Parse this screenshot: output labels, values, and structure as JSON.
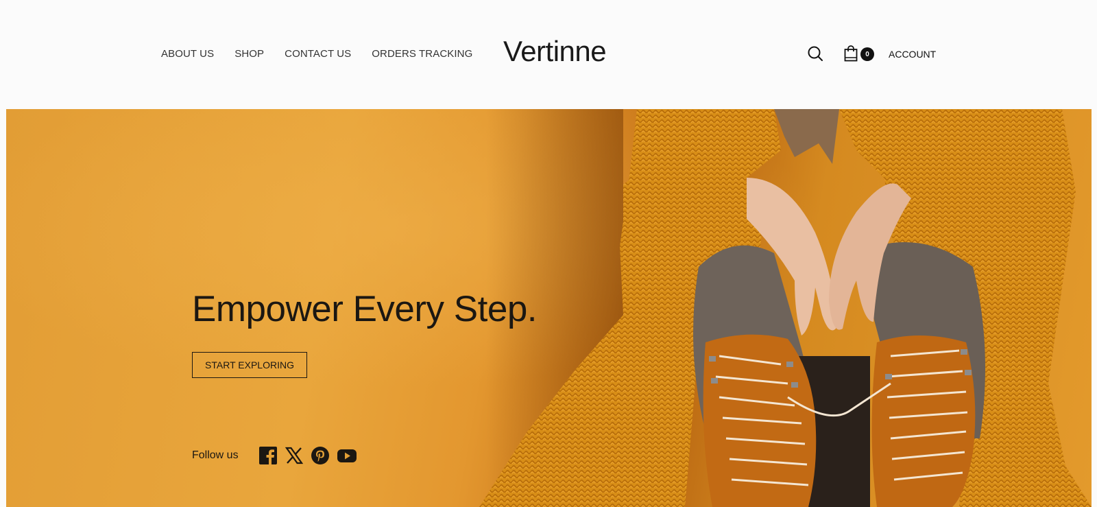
{
  "header": {
    "nav": [
      {
        "label": "ABOUT US"
      },
      {
        "label": "SHOP"
      },
      {
        "label": "CONTACT US"
      },
      {
        "label": "ORDERS TRACKING"
      }
    ],
    "logo": "Vertinne",
    "search_icon": "search-icon",
    "cart_icon": "shopping-bag-icon",
    "cart_count": "0",
    "account_label": "ACCOUNT"
  },
  "hero": {
    "headline": "Empower Every Step.",
    "cta_label": "START EXPLORING",
    "follow_label": "Follow us",
    "social_icons": [
      "facebook-icon",
      "x-icon",
      "pinterest-icon",
      "youtube-icon"
    ],
    "background_color": "#e3a036",
    "image_subject": "woman in mustard knit cardigan with tan lace-up boots"
  },
  "colors": {
    "text_dark": "#1b1712",
    "header_bg": "#fbfbfb",
    "badge_bg": "#111111"
  }
}
